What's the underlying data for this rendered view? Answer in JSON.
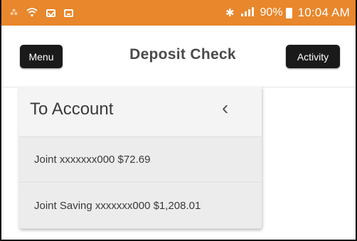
{
  "status_bar": {
    "left_icons": [
      "signal-small-icon",
      "wifi-icon",
      "mail-icon",
      "image-icon"
    ],
    "right_icons": [
      "bluetooth-icon",
      "cell-signal-icon"
    ],
    "battery_percent": "90%",
    "time": "10:04 AM",
    "color": "#e8872c"
  },
  "header": {
    "menu_label": "Menu",
    "title": "Deposit Check",
    "activity_label": "Activity"
  },
  "dropdown": {
    "title": "To Account",
    "accounts": [
      {
        "label": "Joint xxxxxxx000 $72.69"
      },
      {
        "label": "Joint Saving xxxxxxx000 $1,208.01"
      }
    ]
  }
}
